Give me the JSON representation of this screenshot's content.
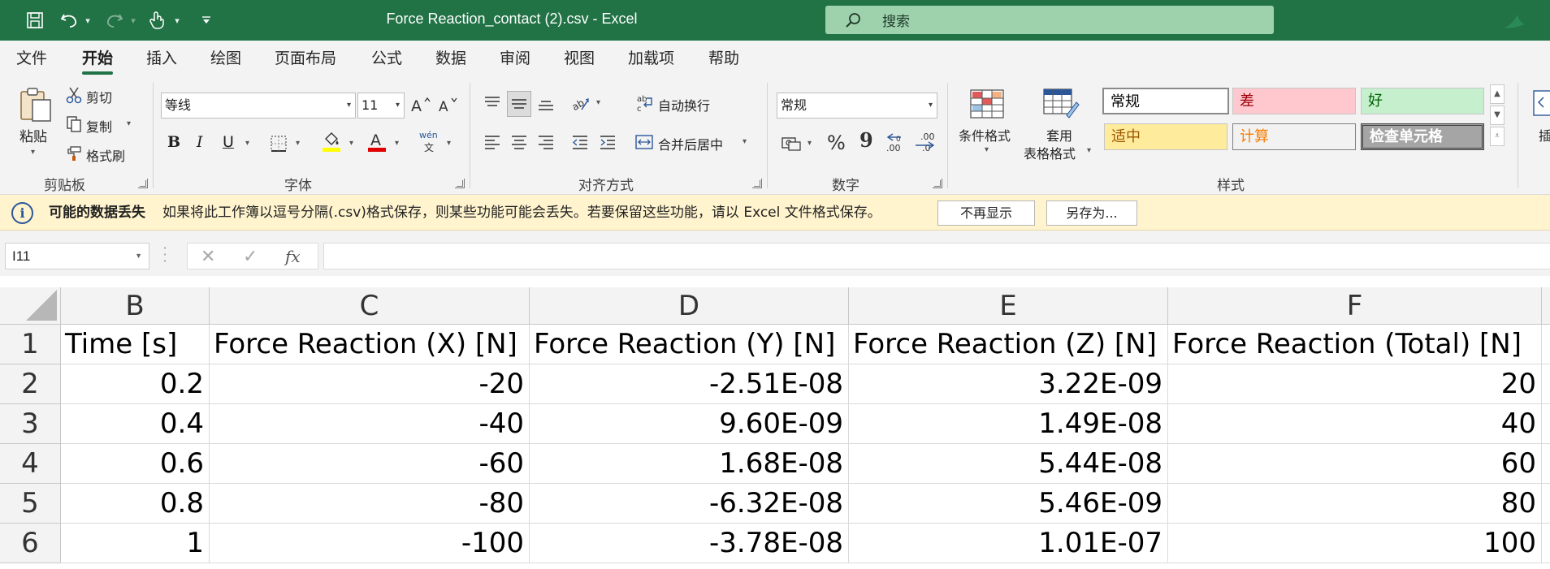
{
  "app": {
    "document_title": "Force Reaction_contact (2).csv  -  Excel",
    "search_placeholder": "搜索",
    "accent_color": "#217346"
  },
  "quick_access": [
    "save-icon",
    "undo-icon",
    "redo-icon",
    "touch-mode-icon",
    "customize-icon"
  ],
  "menu_tabs": [
    "文件",
    "开始",
    "插入",
    "绘图",
    "页面布局",
    "公式",
    "数据",
    "审阅",
    "视图",
    "加载项",
    "帮助"
  ],
  "active_tab": "开始",
  "ribbon": {
    "clipboard": {
      "paste": "粘贴",
      "cut": "剪切",
      "copy": "复制",
      "format_painter": "格式刷",
      "label": "剪贴板"
    },
    "font": {
      "name": "等线",
      "size": "11",
      "bold": "B",
      "italic": "I",
      "underline": "U",
      "phonetic": "wén",
      "phonetic_sub": "文",
      "label": "字体"
    },
    "alignment": {
      "wrap_text": "自动换行",
      "merge_center": "合并后居中",
      "label": "对齐方式"
    },
    "number": {
      "format": "常规",
      "percent": "%",
      "comma": "9",
      "label": "数字"
    },
    "styles": {
      "conditional_formatting": "条件格式",
      "format_as_table_line1": "套用",
      "format_as_table_line2": "表格格式",
      "cells": [
        {
          "label": "常规",
          "bg": "#ffffff",
          "color": "#000000"
        },
        {
          "label": "差",
          "bg": "#ffc7ce",
          "color": "#9c0006"
        },
        {
          "label": "好",
          "bg": "#c6efce",
          "color": "#006100"
        },
        {
          "label": "适中",
          "bg": "#ffeb9c",
          "color": "#9c5700"
        },
        {
          "label": "计算",
          "bg": "#f2f2f2",
          "color": "#fa7d00"
        },
        {
          "label": "检查单元格",
          "bg": "#a5a5a5",
          "color": "#ffffff"
        }
      ],
      "label": "样式"
    },
    "insert_partial": "插"
  },
  "message_bar": {
    "title": "可能的数据丢失",
    "text": "如果将此工作簿以逗号分隔(.csv)格式保存，则某些功能可能会丢失。若要保留这些功能，请以 Excel 文件格式保存。",
    "button_dismiss": "不再显示",
    "button_save_as": "另存为..."
  },
  "formula_bar": {
    "name_box": "I11",
    "formula": ""
  },
  "sheet": {
    "column_headers": [
      "B",
      "C",
      "D",
      "E",
      "F"
    ],
    "row_headers": [
      "1",
      "2",
      "3",
      "4",
      "5",
      "6"
    ],
    "rows": [
      [
        "Time [s]",
        "Force Reaction (X) [N]",
        "Force Reaction (Y) [N]",
        "Force Reaction (Z) [N]",
        "Force Reaction (Total) [N]"
      ],
      [
        "0.2",
        "-20",
        "-2.51E-08",
        "3.22E-09",
        "20"
      ],
      [
        "0.4",
        "-40",
        "9.60E-09",
        "1.49E-08",
        "40"
      ],
      [
        "0.6",
        "-60",
        "1.68E-08",
        "5.44E-08",
        "60"
      ],
      [
        "0.8",
        "-80",
        "-6.32E-08",
        "5.46E-09",
        "80"
      ],
      [
        "1",
        "-100",
        "-3.78E-08",
        "1.01E-07",
        "100"
      ]
    ]
  }
}
